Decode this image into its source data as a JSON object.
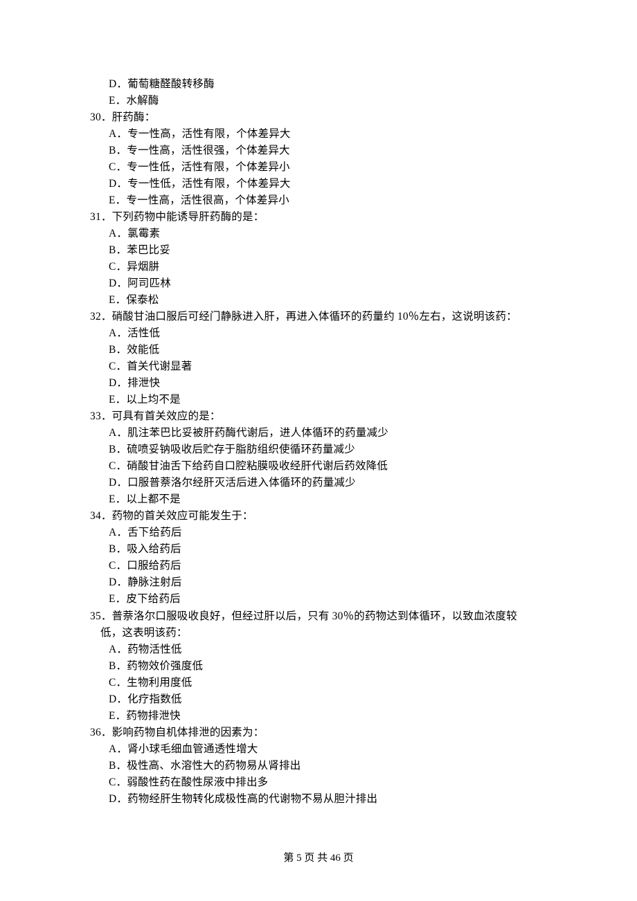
{
  "lead_in_opts": [
    "D．葡萄糖醛酸转移酶",
    "E．水解酶"
  ],
  "questions": [
    {
      "num": "30．",
      "stem": "肝药酶：",
      "opts": [
        "A．专一性高，活性有限，个体差异大",
        "B．专一性高，活性很强，个体差异大",
        "C．专一性低，活性有限，个体差异小",
        "D．专一性低，活性有限，个体差异大",
        "E．专一性高，活性很高，个体差异小"
      ]
    },
    {
      "num": "31．",
      "stem": "下列药物中能诱导肝药酶的是：",
      "opts": [
        "A．氯霉素",
        "B．苯巴比妥",
        "C．异烟肼",
        "D．阿司匹林",
        "E．保泰松"
      ]
    },
    {
      "num": "32．",
      "stem": "硝酸甘油口服后可经门静脉进入肝，再进入体循环的药量约 10％左右，这说明该药：",
      "opts": [
        "A．活性低",
        "B．效能低",
        "C．首关代谢显著",
        "D．排泄快",
        "E．以上均不是"
      ]
    },
    {
      "num": "33．",
      "stem": "可具有首关效应的是：",
      "opts": [
        "A．肌注苯巴比妥被肝药酶代谢后，进人体循环的药量减少",
        "B．硫喷妥钠吸收后贮存于脂肪组织使循环药量减少",
        "C．硝酸甘油舌下给药自口腔粘膜吸收经肝代谢后药效降低",
        "D．口服普萘洛尔经肝灭活后进入体循环的药量减少",
        "E．以上都不是"
      ]
    },
    {
      "num": "34．",
      "stem": "药物的首关效应可能发生于：",
      "opts": [
        "A．舌下给药后",
        "B．吸入给药后",
        "C．口服给药后",
        "D．静脉注射后",
        "E．皮下给药后"
      ]
    },
    {
      "num": "35．",
      "stem": "普萘洛尔口服吸收良好，但经过肝以后，只有 30％的药物达到体循环，以致血浓度较",
      "stem2": "低，这表明该药：",
      "opts": [
        "A．药物活性低",
        "B．药物效价强度低",
        "C．生物利用度低",
        "D．化疗指数低",
        "E．药物排泄快"
      ]
    },
    {
      "num": "36．",
      "stem": "影响药物自机体排泄的因素为：",
      "opts": [
        "A．肾小球毛细血管通透性增大",
        "B．极性高、水溶性大的药物易从肾排出",
        "C．弱酸性药在酸性尿液中排出多",
        "D．药物经肝生物转化成极性高的代谢物不易从胆汁排出"
      ]
    }
  ],
  "footer": {
    "prefix": "第 ",
    "page": "5",
    "middle": " 页 共 ",
    "total": "46",
    "suffix": " 页"
  }
}
